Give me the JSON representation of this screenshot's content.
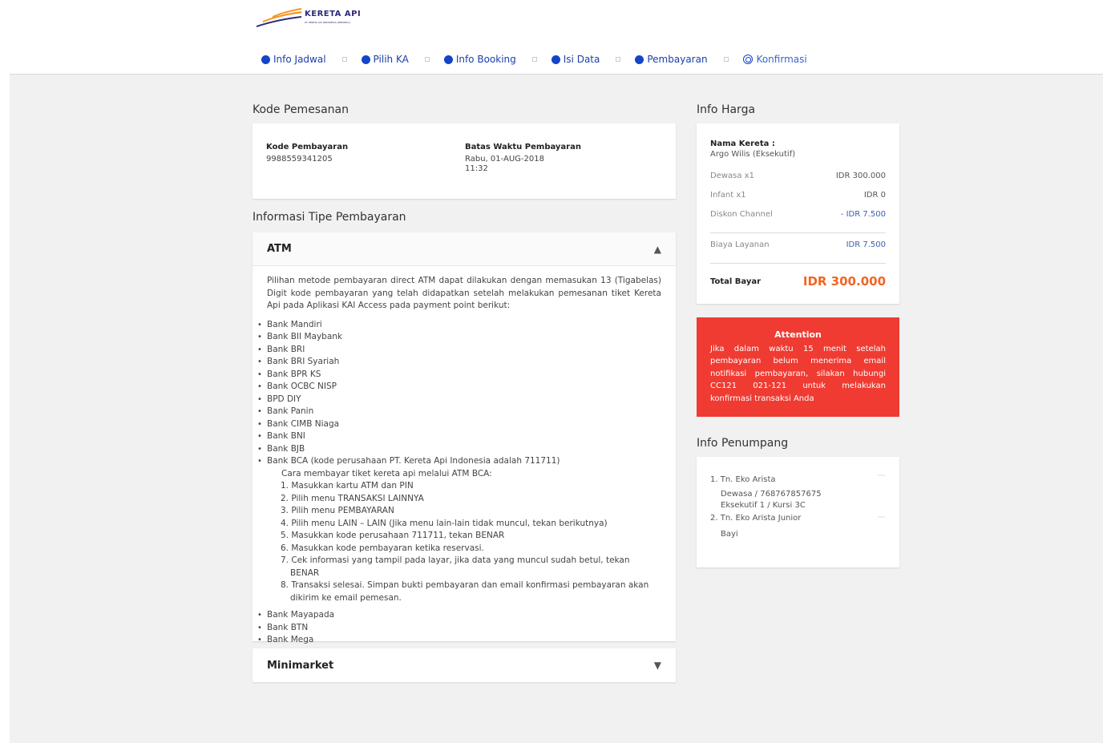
{
  "brand": {
    "logo_text": "KERETA API",
    "logo_sub": "PT KERETA API INDONESIA (PERSERO)"
  },
  "steps": [
    {
      "label": "Info Jadwal",
      "state": "done"
    },
    {
      "label": "Pilih KA",
      "state": "done"
    },
    {
      "label": "Info Booking",
      "state": "done"
    },
    {
      "label": "Isi Data",
      "state": "done"
    },
    {
      "label": "Pembayaran",
      "state": "done"
    },
    {
      "label": "Konfirmasi",
      "state": "current"
    }
  ],
  "kode": {
    "section_title": "Kode Pemesanan",
    "kode_label": "Kode Pembayaran",
    "kode_value": "9988559341205",
    "batas_label": "Batas Waktu Pembayaran",
    "batas_date": "Rabu, 01-AUG-2018",
    "batas_time": "11:32"
  },
  "tipe": {
    "section_title": "Informasi Tipe Pembayaran",
    "atm_label": "ATM",
    "atm_arrow": "▲",
    "intro": "Pilihan metode pembayaran direct ATM dapat dilakukan dengan memasukan 13 (Tigabelas) Digit kode pembayaran yang telah didapatkan setelah melakukan pemesanan tiket Kereta Api pada Aplikasi KAI Access pada payment point berikut:",
    "banks_a": [
      "Bank Mandiri",
      "Bank BII Maybank",
      "Bank BRI",
      "Bank BRI Syariah",
      "Bank BPR KS",
      "Bank OCBC NISP",
      "BPD DIY",
      "Bank Panin",
      "Bank CIMB Niaga",
      "Bank BNI",
      "Bank BJB"
    ],
    "bca_label": "Bank BCA (kode perusahaan PT. Kereta Api Indonesia adalah 711711)",
    "bca_howto": "Cara membayar tiket kereta api melalui ATM BCA:",
    "bca_steps": [
      "1. Masukkan kartu ATM dan PIN",
      "2. Pilih menu TRANSAKSI LAINNYA",
      "3. Pilih menu PEMBAYARAN",
      "4. Pilih menu LAIN – LAIN (Jika menu lain-lain tidak muncul, tekan berikutnya)",
      "5. Masukkan kode perusahaan 711711, tekan BENAR",
      "6. Masukkan kode pembayaran ketika reservasi.",
      "7. Cek informasi yang tampil pada layar, jika data yang muncul sudah betul, tekan BENAR",
      "8. Transaksi selesai. Simpan bukti pembayaran dan email konfirmasi pembayaran akan dikirim ke email pemesan."
    ],
    "banks_b": [
      "Bank Mayapada",
      "Bank BTN",
      "Bank Mega"
    ],
    "minimarket_label": "Minimarket",
    "minimarket_arrow": "▼"
  },
  "harga": {
    "section_title": "Info Harga",
    "kereta_label": "Nama Kereta :",
    "kereta_value": "Argo Wilis (Eksekutif)",
    "dewasa_label": "Dewasa x1",
    "dewasa_value": "IDR 300.000",
    "infant_label": "Infant x1",
    "infant_value": "IDR 0",
    "diskon_label": "Diskon Channel",
    "diskon_value": "- IDR 7.500",
    "biaya_label": "Biaya Layanan",
    "biaya_value": "IDR 7.500",
    "total_label": "Total Bayar",
    "total_value": "IDR 300.000"
  },
  "alert": {
    "title": "Attention",
    "text": "Jika dalam waktu 15 menit setelah pembayaran belum menerima email notifikasi pembayaran, silakan hubungi CC121 021-121 untuk melakukan konfirmasi transaksi Anda"
  },
  "penumpang": {
    "section_title": "Info Penumpang",
    "p1_name": "1. Tn. Eko Arista",
    "p1_type": "Dewasa / 768767857675",
    "p1_seat": "Eksekutif 1 / Kursi 3C",
    "p2_name": "2. Tn. Eko Arista Junior",
    "p2_type": "Bayi"
  },
  "colors": {
    "primary": "#1544c8",
    "alert": "#ef3b32",
    "total": "#f26522"
  }
}
